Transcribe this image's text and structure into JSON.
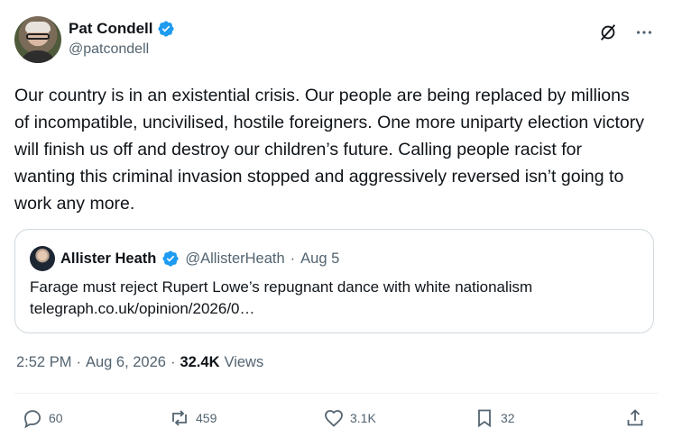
{
  "author": {
    "display_name": "Pat Condell",
    "handle": "@patcondell"
  },
  "tweet": {
    "text": "Our country is in an existential crisis. Our people are being replaced by millions of incompatible, uncivilised, hostile foreigners. One more uniparty election victory will finish us off and destroy our children’s future. Calling people racist for wanting this criminal invasion stopped and aggressively reversed isn’t going to work any more."
  },
  "quote": {
    "display_name": "Allister Heath",
    "handle": "@AllisterHeath",
    "separator": "·",
    "date": "Aug 5",
    "text_line1": "Farage must reject Rupert Lowe’s repugnant dance with white nationalism",
    "text_line2": "telegraph.co.uk/opinion/2026/0…"
  },
  "meta": {
    "time": "2:52 PM",
    "sep1": "·",
    "date": "Aug 6, 2026",
    "sep2": "·",
    "views_count": "32.4K",
    "views_label": "Views"
  },
  "actions": {
    "replies": "60",
    "reposts": "459",
    "likes": "3.1K",
    "bookmarks": "32"
  },
  "colors": {
    "verified": "#1d9bf0",
    "secondary_text": "#536471",
    "border": "#cfd9de"
  },
  "icons": [
    "verified-badge-icon",
    "grok-icon",
    "more-icon",
    "reply-icon",
    "repost-icon",
    "like-icon",
    "bookmark-icon",
    "share-icon"
  ]
}
